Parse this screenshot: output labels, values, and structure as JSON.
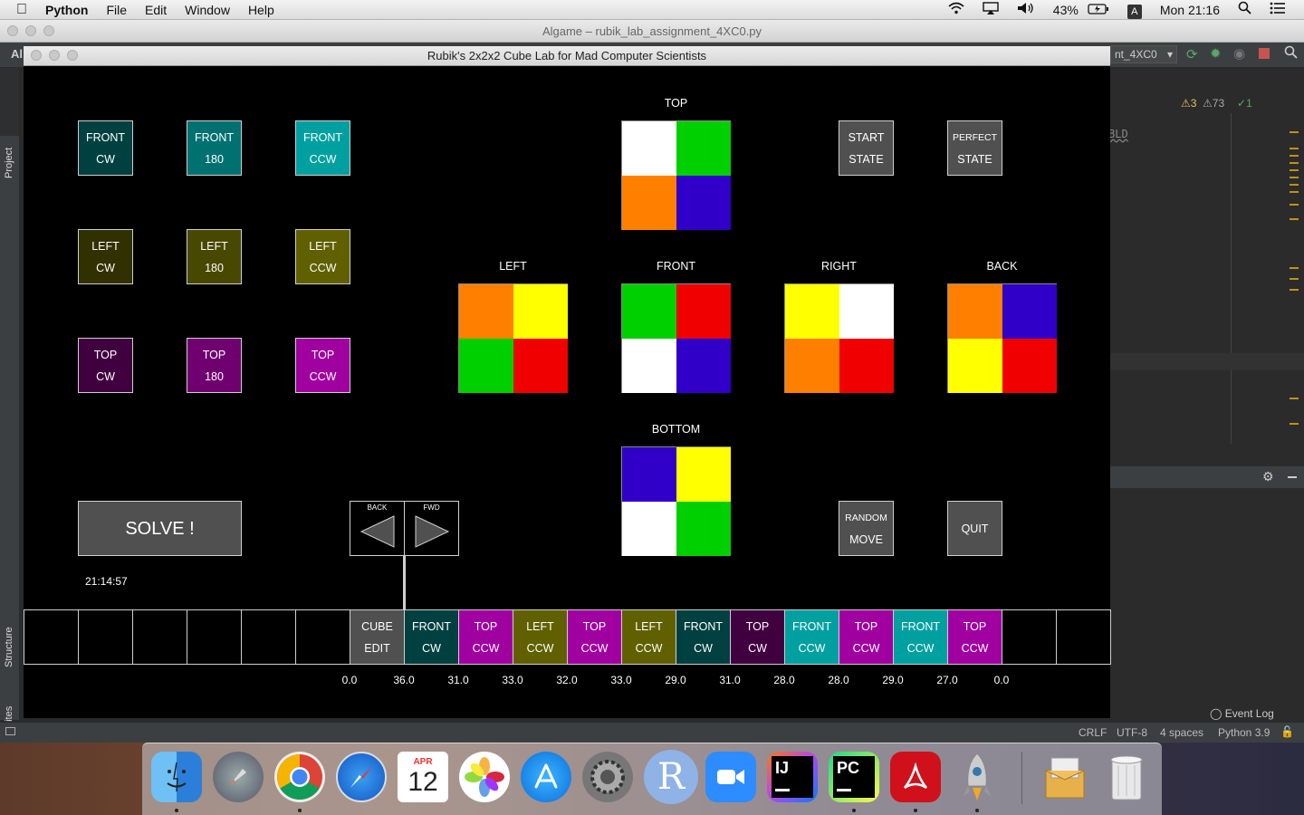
{
  "menubar": {
    "app": "Python",
    "items": [
      "File",
      "Edit",
      "Window",
      "Help"
    ],
    "battery": "43%",
    "clock": "Mon 21:16",
    "input_source": "A"
  },
  "ide": {
    "window_title": "Algame – rubik_lab_assignment_4XC0.py",
    "run_config": "nt_4XC0",
    "project_tab": "Project",
    "structure_tab": "Structure",
    "favorites_tab": "Favorites",
    "inspections": {
      "warnings": "3",
      "weak": "73",
      "ok": "1"
    },
    "editor_snippet": "BLD",
    "event_log": "Event Log",
    "status": {
      "line_sep": "CRLF",
      "encoding": "UTF-8",
      "indent": "4 spaces",
      "interpreter": "Python 3.9"
    },
    "left_label": "Al"
  },
  "game": {
    "title": "Rubik's 2x2x2 Cube Lab for Mad Computer Scientists",
    "move_buttons": [
      {
        "l1": "FRONT",
        "l2": "CW",
        "color": "#004040"
      },
      {
        "l1": "FRONT",
        "l2": "180",
        "color": "#007070"
      },
      {
        "l1": "FRONT",
        "l2": "CCW",
        "color": "#00a0a0"
      },
      {
        "l1": "LEFT",
        "l2": "CW",
        "color": "#303000"
      },
      {
        "l1": "LEFT",
        "l2": "180",
        "color": "#484800"
      },
      {
        "l1": "LEFT",
        "l2": "CCW",
        "color": "#606000"
      },
      {
        "l1": "TOP",
        "l2": "CW",
        "color": "#400040"
      },
      {
        "l1": "TOP",
        "l2": "180",
        "color": "#700070"
      },
      {
        "l1": "TOP",
        "l2": "CCW",
        "color": "#a000a0"
      }
    ],
    "state_buttons": [
      {
        "l1": "START",
        "l2": "STATE"
      },
      {
        "l1": "PERFECT",
        "l2": "STATE"
      }
    ],
    "faces": {
      "top": {
        "label": "TOP",
        "colors": [
          "#ffffff",
          "#00d000",
          "#ff8000",
          "#3000c8"
        ]
      },
      "left": {
        "label": "LEFT",
        "colors": [
          "#ff8000",
          "#ffff00",
          "#00d000",
          "#f00000"
        ]
      },
      "front": {
        "label": "FRONT",
        "colors": [
          "#00d000",
          "#f00000",
          "#ffffff",
          "#3000c8"
        ]
      },
      "right": {
        "label": "RIGHT",
        "colors": [
          "#ffff00",
          "#ffffff",
          "#ff8000",
          "#f00000"
        ]
      },
      "back": {
        "label": "BACK",
        "colors": [
          "#ff8000",
          "#3000c8",
          "#ffff00",
          "#f00000"
        ]
      },
      "bottom": {
        "label": "BOTTOM",
        "colors": [
          "#3000c8",
          "#ffff00",
          "#ffffff",
          "#00d000"
        ]
      }
    },
    "solve_label": "SOLVE !",
    "timer": "21:14:57",
    "back_label": "BACK",
    "fwd_label": "FWD",
    "random_move": {
      "l1": "RANDOM",
      "l2": "MOVE"
    },
    "quit_label": "QUIT",
    "timeline": [
      {
        "l1": "",
        "l2": "",
        "color": "#000000"
      },
      {
        "l1": "",
        "l2": "",
        "color": "#000000"
      },
      {
        "l1": "",
        "l2": "",
        "color": "#000000"
      },
      {
        "l1": "",
        "l2": "",
        "color": "#000000"
      },
      {
        "l1": "",
        "l2": "",
        "color": "#000000"
      },
      {
        "l1": "",
        "l2": "",
        "color": "#000000"
      },
      {
        "l1": "CUBE",
        "l2": "EDIT",
        "color": "#505050"
      },
      {
        "l1": "FRONT",
        "l2": "CW",
        "color": "#004040"
      },
      {
        "l1": "TOP",
        "l2": "CCW",
        "color": "#a000a0"
      },
      {
        "l1": "LEFT",
        "l2": "CCW",
        "color": "#606000"
      },
      {
        "l1": "TOP",
        "l2": "CCW",
        "color": "#a000a0"
      },
      {
        "l1": "LEFT",
        "l2": "CCW",
        "color": "#606000"
      },
      {
        "l1": "FRONT",
        "l2": "CW",
        "color": "#004040"
      },
      {
        "l1": "TOP",
        "l2": "CW",
        "color": "#400040"
      },
      {
        "l1": "FRONT",
        "l2": "CCW",
        "color": "#00a0a0"
      },
      {
        "l1": "TOP",
        "l2": "CCW",
        "color": "#a000a0"
      },
      {
        "l1": "FRONT",
        "l2": "CCW",
        "color": "#00a0a0"
      },
      {
        "l1": "TOP",
        "l2": "CCW",
        "color": "#a000a0"
      },
      {
        "l1": "",
        "l2": "",
        "color": "#000000"
      },
      {
        "l1": "",
        "l2": "",
        "color": "#000000"
      }
    ],
    "timeline_values": [
      "0.0",
      "36.0",
      "31.0",
      "33.0",
      "32.0",
      "33.0",
      "29.0",
      "31.0",
      "28.0",
      "28.0",
      "29.0",
      "27.0",
      "0.0"
    ]
  },
  "dock": {
    "calendar_month": "APR",
    "calendar_day": "12",
    "r_label": "R",
    "ij_label": "IJ",
    "pc_label": "PC"
  }
}
